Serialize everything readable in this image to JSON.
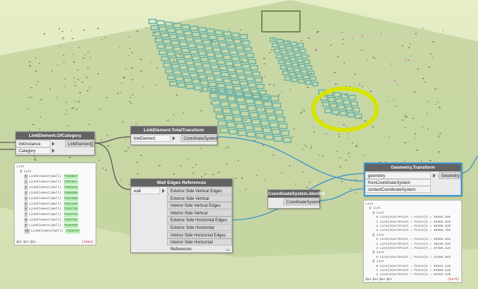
{
  "nodes": {
    "of_category": {
      "title": "LinkElement.OfCategory",
      "inputs": [
        "linkInstance",
        "Category"
      ],
      "output": "LinkElement[]"
    },
    "total_transform": {
      "title": "LinkElement.TotalTransform",
      "input": "linkElement",
      "output": "CoordinateSystem"
    },
    "wall_edges": {
      "title": "Wall Edges References",
      "input": "wall",
      "outputs": [
        "Exterior Side Vertical Edges",
        "Exterior Side Vertical References",
        "Interior Side Vertical Edges",
        "Interior Side Vertical References",
        "Exterior Side Horizontal Edges",
        "Exterior Side Horizontal References",
        "Interior Side Horizontal Edges",
        "Interior Side Horizontal References"
      ],
      "footer": "1/1"
    },
    "cs_identity": {
      "title": "CoordinateSystem.Identity",
      "output": "CoordinateSystem"
    },
    "geometry_transform": {
      "title": "Geometry.Transform",
      "inputs": [
        "geometry",
        "fromCoordinateSystem",
        "contextCoordinateSystem"
      ],
      "output": "Geometry"
    }
  },
  "preview_left": {
    "header": "List",
    "subheader": "@ List",
    "items": [
      {
        "index": "0",
        "type": "LinkElement(Wall)",
        "value": "7255827"
      },
      {
        "index": "1",
        "type": "LinkElement(Wall)",
        "value": "7467017"
      },
      {
        "index": "2",
        "type": "LinkElement(Wall)",
        "value": "7509373"
      },
      {
        "index": "3",
        "type": "LinkElement(Wall)",
        "value": "7509390"
      },
      {
        "index": "4",
        "type": "LinkElement(Wall)",
        "value": "7512509"
      },
      {
        "index": "5",
        "type": "LinkElement(Wall)",
        "value": "7512338"
      },
      {
        "index": "6",
        "type": "LinkElement(Wall)",
        "value": "7526748"
      },
      {
        "index": "7",
        "type": "LinkElement(Wall)",
        "value": "7526754"
      },
      {
        "index": "8",
        "type": "LinkElement(Wall)",
        "value": "7526755"
      },
      {
        "index": "9",
        "type": "LinkElement(Wall)",
        "value": "7526756"
      },
      {
        "index": "10",
        "type": "LinkElement(Wall)",
        "value": "7526757"
      }
    ],
    "footer": "@L3 @L2 @L1",
    "count": "{1094}"
  },
  "preview_right": {
    "rows": [
      {
        "text": "List",
        "indent": 0
      },
      {
        "text": "@ List",
        "indent": 1
      },
      {
        "text": "@ List",
        "indent": 2
      },
      {
        "text": "0  Line(StartPoint = Point(X = 38358.826",
        "indent": 3
      },
      {
        "text": "1  Line(StartPoint = Point(X = 38358.834",
        "indent": 3
      },
      {
        "text": "2  Line(StartPoint = Point(X = 38358.830",
        "indent": 3
      },
      {
        "text": "3  Line(StartPoint = Point(X = 38358.756",
        "indent": 3
      },
      {
        "text": "@ List",
        "indent": 2
      },
      {
        "text": "0  Line(StartPoint = Point(X = 38358.834",
        "indent": 3
      },
      {
        "text": "1  Line(StartPoint = Point(X = 38238.834",
        "indent": 3
      },
      {
        "text": "2  Line(StartPoint = Point(X = 37258.124",
        "indent": 3
      },
      {
        "text": "@ List",
        "indent": 2
      },
      {
        "text": "0  Line(StartPoint = Point(X = 37258.563",
        "indent": 3
      },
      {
        "text": "@ List",
        "indent": 2
      },
      {
        "text": "0  Line(StartPoint = Point(X = 32912.128",
        "indent": 3
      },
      {
        "text": "1  Line(StartPoint = Point(X = 53490.128",
        "indent": 3
      },
      {
        "text": "2  Line(StartPoint = Point(X = 53762.128",
        "indent": 3
      }
    ],
    "footer": "@L4 @L3 @L2 @L1",
    "count": "{5476}"
  },
  "colors": {
    "background": "#d4e2b4",
    "ground": "#bfd19a",
    "building": "#6fb3a8",
    "highlight": "#d8e600",
    "wire_gray": "#555555",
    "wire_blue": "#3a8fd0"
  }
}
